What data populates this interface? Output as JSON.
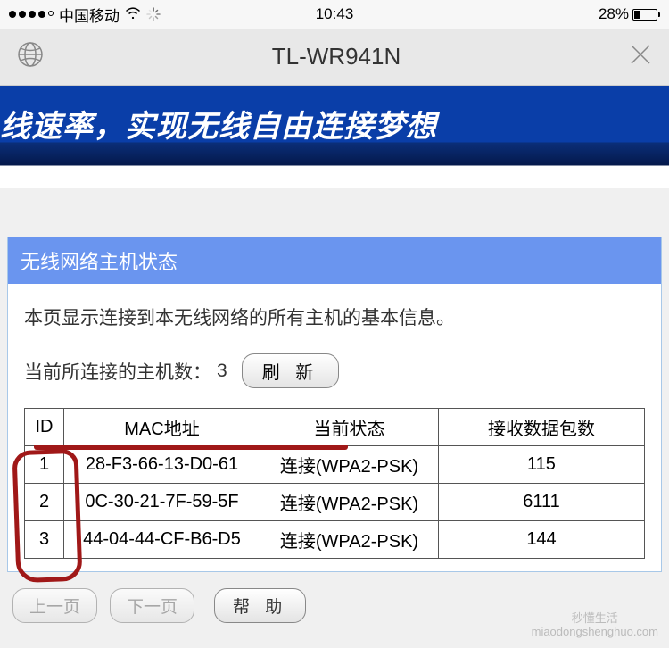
{
  "status_bar": {
    "carrier": "中国移动",
    "time": "10:43",
    "battery_pct": "28%"
  },
  "browser": {
    "title": "TL-WR941N"
  },
  "banner": {
    "text": "线速率，实现无线自由连接梦想"
  },
  "panel": {
    "header": "无线网络主机状态",
    "description": "本页显示连接到本无线网络的所有主机的基本信息。",
    "host_count_label": "当前所连接的主机数：",
    "host_count_value": "3",
    "refresh_label": "刷 新",
    "columns": {
      "id": "ID",
      "mac": "MAC地址",
      "status": "当前状态",
      "rx": "接收数据包数"
    },
    "rows": [
      {
        "id": "1",
        "mac": "28-F3-66-13-D0-61",
        "status": "连接(WPA2-PSK)",
        "rx": "115"
      },
      {
        "id": "2",
        "mac": "0C-30-21-7F-59-5F",
        "status": "连接(WPA2-PSK)",
        "rx": "6111"
      },
      {
        "id": "3",
        "mac": "44-04-44-CF-B6-D5",
        "status": "连接(WPA2-PSK)",
        "rx": "144"
      }
    ]
  },
  "pager": {
    "prev": "上一页",
    "next": "下一页",
    "help": "帮 助"
  },
  "watermark": {
    "line1": "秒懂生活",
    "line2": "miaodongshenghuo.com"
  }
}
